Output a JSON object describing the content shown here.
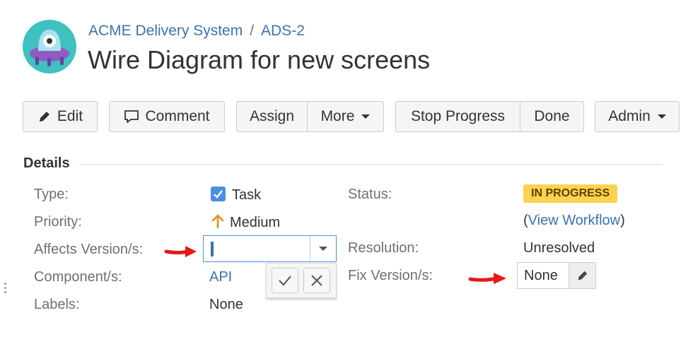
{
  "breadcrumb": {
    "project": "ACME Delivery System",
    "separator": "/",
    "issue_key": "ADS-2"
  },
  "issue": {
    "title": "Wire Diagram for new screens"
  },
  "toolbar": {
    "edit": "Edit",
    "comment": "Comment",
    "assign": "Assign",
    "more": "More",
    "stop_progress": "Stop Progress",
    "done": "Done",
    "admin": "Admin"
  },
  "details": {
    "heading": "Details",
    "type_label": "Type:",
    "type_value": "Task",
    "priority_label": "Priority:",
    "priority_value": "Medium",
    "affects_label": "Affects Version/s:",
    "affects_value": "",
    "component_label": "Component/s:",
    "component_value": "API",
    "labels_label": "Labels:",
    "labels_value": "None",
    "status_label": "Status:",
    "status_value": "IN PROGRESS",
    "workflow_open": "(",
    "workflow_link": "View Workflow",
    "workflow_close": ")",
    "resolution_label": "Resolution:",
    "resolution_value": "Unresolved",
    "fix_label": "Fix Version/s:",
    "fix_value": "None"
  },
  "colors": {
    "link": "#3b73af",
    "status_badge": "#ffd351",
    "annotation_arrow": "#e31b1b",
    "priority_arrow": "#f08a24"
  }
}
